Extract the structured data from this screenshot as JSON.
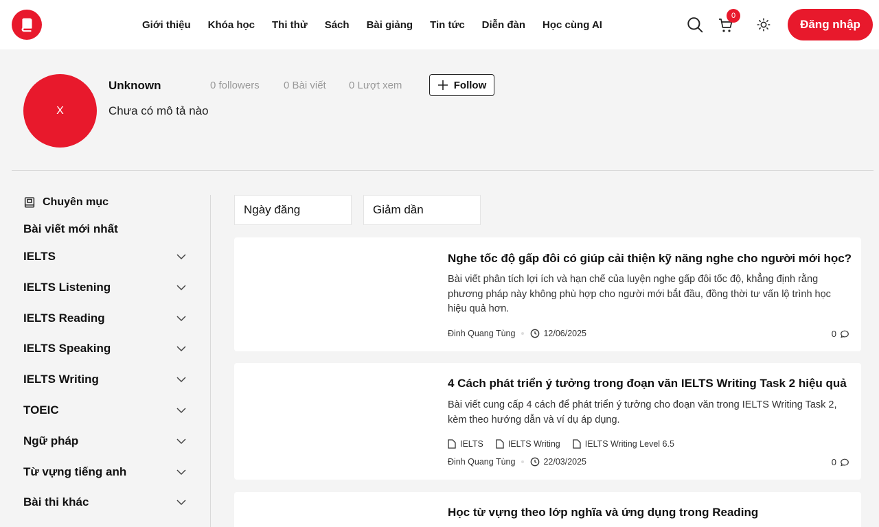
{
  "header": {
    "logo_icon": "book-logo-icon",
    "nav": [
      "Giới thiệu",
      "Khóa học",
      "Thi thử",
      "Sách",
      "Bài giảng",
      "Tin tức",
      "Diễn đàn",
      "Học cùng AI"
    ],
    "cart_count": "0",
    "login_label": "Đăng nhập",
    "brand_color": "#e8192c"
  },
  "profile": {
    "avatar_text": "X",
    "name": "Unknown",
    "description": "Chưa có mô tả nào",
    "followers": "0 followers",
    "posts": "0 Bài viết",
    "views": "0 Lượt xem",
    "follow_label": "Follow"
  },
  "sidebar": {
    "title": "Chuyên mục",
    "latest": "Bài viết mới nhất",
    "categories": [
      "IELTS",
      "IELTS Listening",
      "IELTS Reading",
      "IELTS Speaking",
      "IELTS Writing",
      "TOEIC",
      "Ngữ pháp",
      "Từ vựng tiếng anh",
      "Bài thi khác"
    ]
  },
  "filters": {
    "sort_by": "Ngày đăng",
    "order": "Giảm dần"
  },
  "posts": [
    {
      "title": "Nghe tốc độ gấp đôi có giúp cải thiện kỹ năng nghe cho người mới học?",
      "description": "Bài viết phân tích lợi ích và hạn chế của luyện nghe gấp đôi tốc độ, khẳng định rằng phương pháp này không phù hợp cho người mới bắt đầu, đồng thời tư vấn lộ trình học hiệu quả hơn.",
      "author": "Đinh Quang Tùng",
      "date": "12/06/2025",
      "comments": "0",
      "tags": []
    },
    {
      "title": "4 Cách phát triển ý tưởng trong đoạn văn IELTS Writing Task 2 hiệu quả",
      "description": "Bài viết cung cấp 4 cách để phát triển ý tưởng cho đoạn văn trong IELTS Writing Task 2, kèm theo hướng dẫn và ví dụ áp dụng.",
      "author": "Đinh Quang Tùng",
      "date": "22/03/2025",
      "comments": "0",
      "tags": [
        "IELTS",
        "IELTS Writing",
        "IELTS Writing Level 6.5"
      ]
    },
    {
      "title": "Học từ vựng theo lớp nghĩa và ứng dụng trong Reading"
    }
  ]
}
